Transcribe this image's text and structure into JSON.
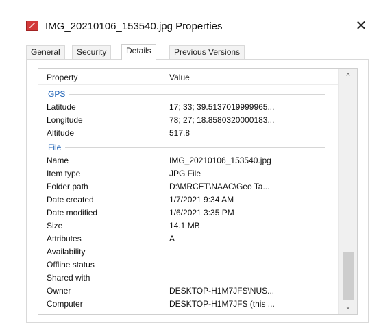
{
  "window": {
    "title": "IMG_20210106_153540.jpg Properties",
    "close_glyph": "✕"
  },
  "tabs": [
    {
      "label": "General",
      "active": false
    },
    {
      "label": "Security",
      "active": false
    },
    {
      "label": "Details",
      "active": true
    },
    {
      "label": "Previous Versions",
      "active": false
    }
  ],
  "list": {
    "headers": {
      "property": "Property",
      "value": "Value"
    },
    "groups": [
      {
        "label": "GPS",
        "rows": [
          {
            "property": "Latitude",
            "value": "17; 33; 39.5137019999965..."
          },
          {
            "property": "Longitude",
            "value": "78; 27; 18.8580320000183..."
          },
          {
            "property": "Altitude",
            "value": "517.8"
          }
        ]
      },
      {
        "label": "File",
        "rows": [
          {
            "property": "Name",
            "value": "IMG_20210106_153540.jpg"
          },
          {
            "property": "Item type",
            "value": "JPG File"
          },
          {
            "property": "Folder path",
            "value": "D:\\MRCET\\NAAC\\Geo Ta..."
          },
          {
            "property": "Date created",
            "value": "1/7/2021 9:34 AM"
          },
          {
            "property": "Date modified",
            "value": "1/6/2021 3:35 PM"
          },
          {
            "property": "Size",
            "value": "14.1 MB"
          },
          {
            "property": "Attributes",
            "value": "A"
          },
          {
            "property": "Availability",
            "value": ""
          },
          {
            "property": "Offline status",
            "value": ""
          },
          {
            "property": "Shared with",
            "value": ""
          },
          {
            "property": "Owner",
            "value": "DESKTOP-H1M7JFS\\NUS..."
          },
          {
            "property": "Computer",
            "value": "DESKTOP-H1M7JFS (this ..."
          }
        ]
      }
    ]
  },
  "scrollbar": {
    "up_glyph": "^",
    "down_glyph": "⌄"
  },
  "colors": {
    "group_label": "#1a5fb4",
    "title_icon": "#d23a3a"
  }
}
